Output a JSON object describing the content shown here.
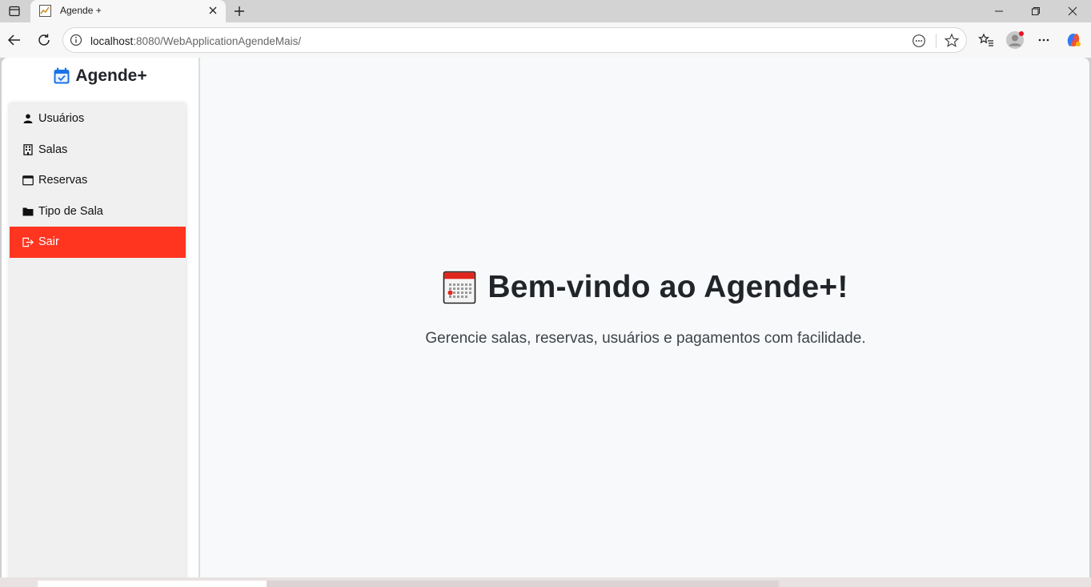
{
  "browser": {
    "tab_title": "Agende +",
    "url_host": "localhost",
    "url_rest": ":8080/WebApplicationAgendeMais/",
    "icons": [
      "tab-actions-icon",
      "close-icon",
      "plus-icon",
      "minimize-icon",
      "restore-icon",
      "close-window-icon",
      "back-arrow-icon",
      "reload-icon",
      "info-icon",
      "reading-view-icon",
      "star-icon",
      "favorites-list-icon",
      "profile-avatar-icon",
      "more-icon",
      "copilot-icon"
    ]
  },
  "sidebar": {
    "brand": "Agende+",
    "items": [
      {
        "label": "Usuários",
        "icon": "person-icon",
        "active": false
      },
      {
        "label": "Salas",
        "icon": "building-icon",
        "active": false
      },
      {
        "label": "Reservas",
        "icon": "calendar-icon",
        "active": false
      },
      {
        "label": "Tipo de Sala",
        "icon": "folder-icon",
        "active": false
      },
      {
        "label": "Sair",
        "icon": "logout-icon",
        "active": true
      }
    ]
  },
  "main": {
    "title": "Bem-vindo ao Agende+!",
    "subtitle": "Gerencie salas, reservas, usuários e pagamentos com facilidade."
  },
  "colors": {
    "accent_red": "#ff3520",
    "brand_blue": "#1a73e8",
    "page_bg": "#f8f9fa"
  }
}
